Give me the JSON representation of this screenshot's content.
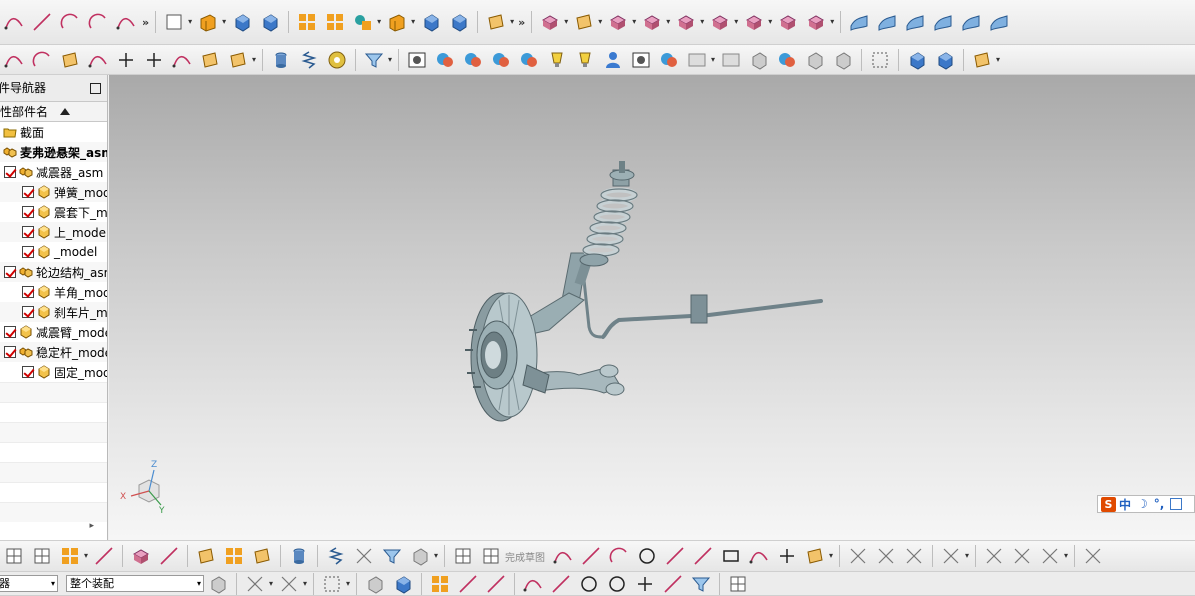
{
  "navigator": {
    "title": "部件导航器",
    "column_header": "描述性部件名",
    "rows": [
      {
        "label": "截面",
        "level": 0,
        "checked": false,
        "icon": "folder-icon"
      },
      {
        "label": "麦弗逊悬架_asm",
        "level": 0,
        "checked": false,
        "icon": "assembly-icon",
        "bold": true
      },
      {
        "label": "减震器_asm",
        "level": 1,
        "checked": true,
        "icon": "assembly-icon"
      },
      {
        "label": "弹簧_model",
        "level": 2,
        "checked": true,
        "icon": "part-icon"
      },
      {
        "label": "震套下_model",
        "level": 2,
        "checked": true,
        "icon": "part-icon"
      },
      {
        "label": "上_model",
        "level": 2,
        "checked": true,
        "icon": "part-icon"
      },
      {
        "label": "_model",
        "level": 2,
        "checked": true,
        "icon": "part-icon"
      },
      {
        "label": "轮边结构_asm",
        "level": 1,
        "checked": true,
        "icon": "assembly-icon"
      },
      {
        "label": "羊角_model",
        "level": 2,
        "checked": true,
        "icon": "part-icon"
      },
      {
        "label": "刹车片_model",
        "level": 2,
        "checked": true,
        "icon": "part-icon"
      },
      {
        "label": "减震臂_model",
        "level": 1,
        "checked": true,
        "icon": "part-icon"
      },
      {
        "label": "稳定杆_model",
        "level": 1,
        "checked": true,
        "icon": "assembly-icon"
      },
      {
        "label": "固定_model",
        "level": 2,
        "checked": true,
        "icon": "part-icon"
      }
    ]
  },
  "viewport": {
    "triad": {
      "x": "X",
      "y": "Y",
      "z": "Z"
    },
    "ime": {
      "brand": "S",
      "mode": "中",
      "moon": "☽",
      "punct": "°,"
    }
  },
  "sketch_toolbar": {
    "complete_sketch": "完成草图"
  },
  "selection_bar": {
    "filter_value": "无选择过滤器",
    "scope_value": "整个装配"
  },
  "colors": {
    "accent_orange": "#f0a020",
    "accent_blue": "#3c78c8",
    "check_red": "#d00000"
  }
}
